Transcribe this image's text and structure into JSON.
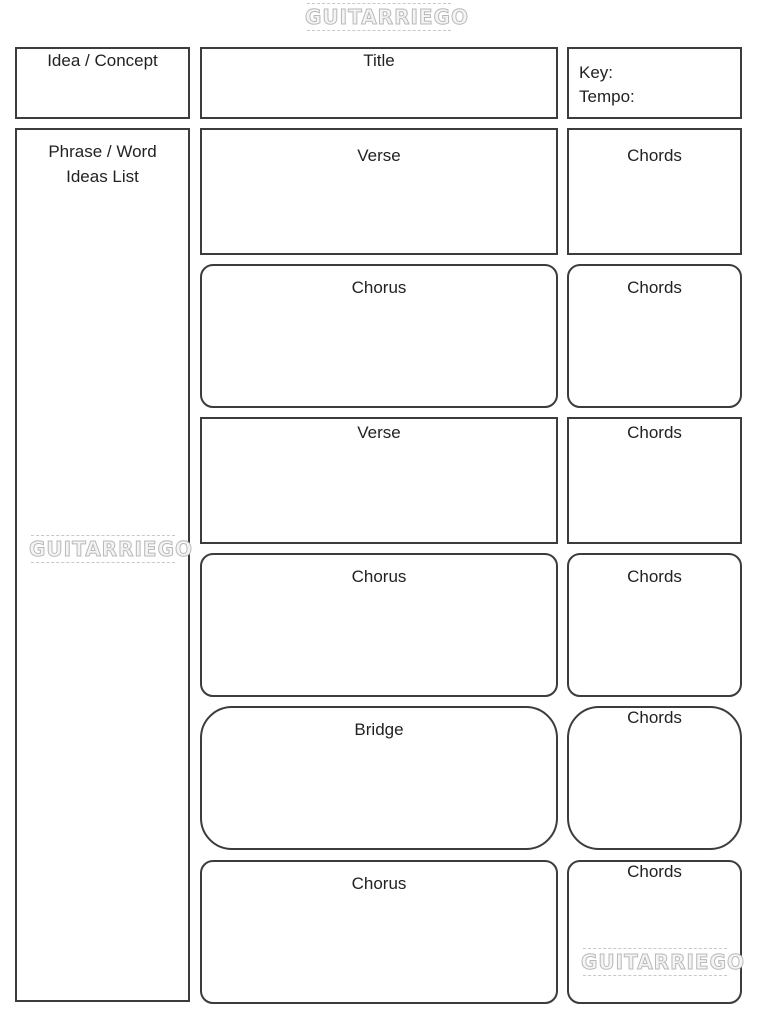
{
  "watermark": "GUITARRIEGO",
  "header": {
    "idea_label": "Idea / Concept",
    "title_label": "Title",
    "key_label": "Key:",
    "tempo_label": "Tempo:"
  },
  "sidebar": {
    "label_line1": "Phrase / Word",
    "label_line2": "Ideas List"
  },
  "sections": [
    {
      "label": "Verse",
      "chords_label": "Chords"
    },
    {
      "label": "Chorus",
      "chords_label": "Chords"
    },
    {
      "label": "Verse",
      "chords_label": "Chords"
    },
    {
      "label": "Chorus",
      "chords_label": "Chords"
    },
    {
      "label": "Bridge",
      "chords_label": "Chords"
    },
    {
      "label": "Chorus",
      "chords_label": "Chords"
    }
  ]
}
